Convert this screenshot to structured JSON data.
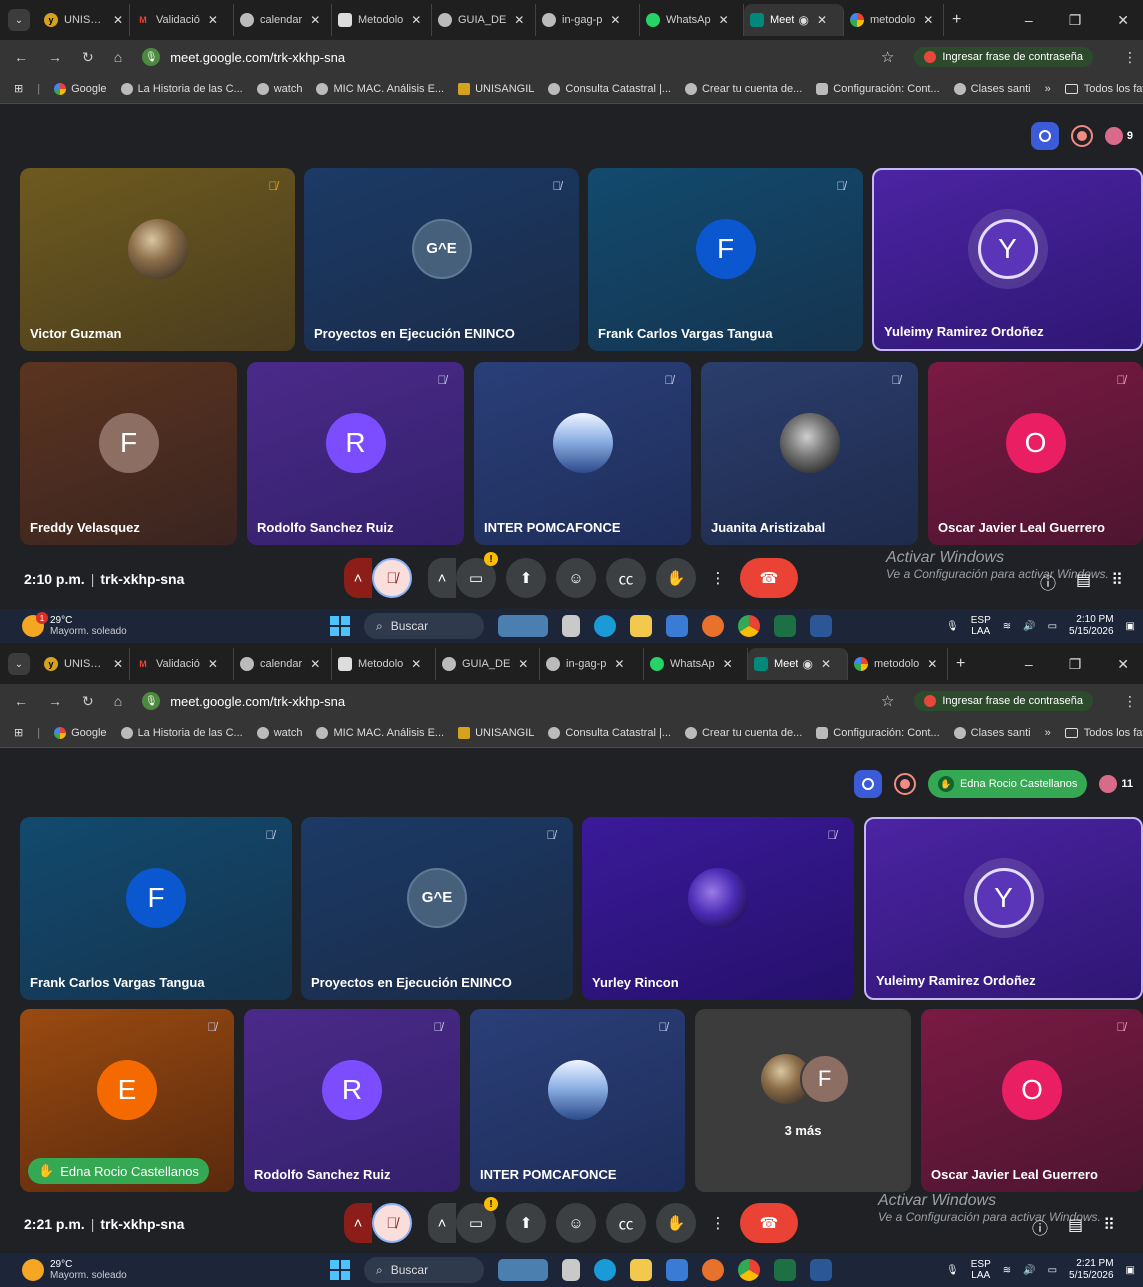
{
  "screens": [
    {
      "tabs": [
        "UNISANG",
        "Validació",
        "calendar",
        "Metodolo",
        "GUIA_DE",
        "in-gag-p",
        "WhatsAp",
        "Meet",
        "metodolo"
      ],
      "url": "meet.google.com/trk-xkhp-sna",
      "password_prompt": "Ingresar frase de contraseña",
      "bookmarks": [
        "Google",
        "La Historia de las C...",
        "watch",
        "MIC MAC. Análisis E...",
        "UNISANGIL",
        "Consulta Catastral |...",
        "Crear tu cuenta de...",
        "Configuración: Cont...",
        "Clases santi"
      ],
      "bookmarks_more": "»",
      "all_favorites": "Todos los favoritos",
      "participant_count": "9",
      "tiles_row1": [
        {
          "name": "Victor Guzman",
          "initial": ""
        },
        {
          "name": "Proyectos en Ejecución ENINCO",
          "initial": "G^E"
        },
        {
          "name": "Frank Carlos Vargas Tangua",
          "initial": "F"
        },
        {
          "name": "Yuleimy Ramirez Ordoñez",
          "initial": "Y"
        }
      ],
      "tiles_row2": [
        {
          "name": "Freddy Velasquez",
          "initial": "F"
        },
        {
          "name": "Rodolfo Sanchez Ruiz",
          "initial": "R"
        },
        {
          "name": "INTER POMCAFONCE",
          "initial": ""
        },
        {
          "name": "Juanita Aristizabal",
          "initial": ""
        },
        {
          "name": "Oscar Javier Leal Guerrero",
          "initial": "O"
        }
      ],
      "time": "2:10 p.m.",
      "meeting_code": "trk-xkhp-sna",
      "activate_title": "Activar Windows",
      "activate_sub": "Ve a Configuración para activar Windows.",
      "weather_temp": "29°C",
      "weather_desc": "Mayorm. soleado",
      "weather_badge": "1",
      "search": "Buscar",
      "lang": "ESP",
      "lang_sub": "LAA",
      "clock": "2:10 PM",
      "date": "5/15/2026"
    },
    {
      "tabs": [
        "UNISANG",
        "Validació",
        "calendar",
        "Metodolo",
        "GUIA_DE",
        "in-gag-p",
        "WhatsAp",
        "Meet",
        "metodolo"
      ],
      "url": "meet.google.com/trk-xkhp-sna",
      "password_prompt": "Ingresar frase de contraseña",
      "bookmarks": [
        "Google",
        "La Historia de las C...",
        "watch",
        "MIC MAC. Análisis E...",
        "UNISANGIL",
        "Consulta Catastral |...",
        "Crear tu cuenta de...",
        "Configuración: Cont...",
        "Clases santi"
      ],
      "bookmarks_more": "»",
      "all_favorites": "Todos los favoritos",
      "hand_raised_name": "Edna Rocio Castellanos",
      "participant_count": "11",
      "tiles_row1": [
        {
          "name": "Frank Carlos Vargas Tangua",
          "initial": "F"
        },
        {
          "name": "Proyectos en Ejecución ENINCO",
          "initial": "G^E"
        },
        {
          "name": "Yurley Rincon",
          "initial": ""
        },
        {
          "name": "Yuleimy Ramirez Ordoñez",
          "initial": "Y"
        }
      ],
      "tiles_row2": [
        {
          "name": "Edna Rocio Castellanos",
          "initial": "E"
        },
        {
          "name": "Rodolfo Sanchez Ruiz",
          "initial": "R"
        },
        {
          "name": "INTER POMCAFONCE",
          "initial": ""
        },
        {
          "name": "3 más",
          "initial": "F"
        },
        {
          "name": "Oscar Javier Leal Guerrero",
          "initial": "O"
        }
      ],
      "time": "2:21 p.m.",
      "meeting_code": "trk-xkhp-sna",
      "activate_title": "Activar Windows",
      "activate_sub": "Ve a Configuración para activar Windows.",
      "weather_temp": "29°C",
      "weather_desc": "Mayorm. soleado",
      "search": "Buscar",
      "lang": "ESP",
      "lang_sub": "LAA",
      "clock": "2:21 PM",
      "date": "5/15/2026"
    }
  ],
  "colors": {
    "hand_raise": "#34a853",
    "hangup": "#ea4335",
    "mic_off_bg": "#f9dedc"
  }
}
